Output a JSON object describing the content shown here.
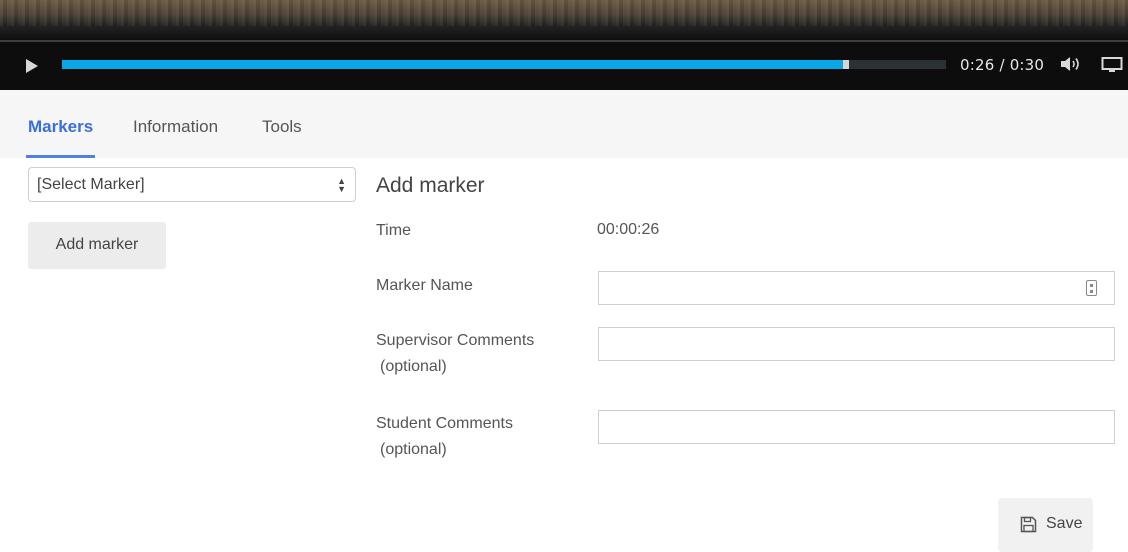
{
  "player": {
    "current_time": "0:26",
    "separator": "/",
    "duration": "0:30",
    "progress_fraction": 0.887,
    "accent_color": "#0aa7e6",
    "icons": [
      "play-icon",
      "volume-icon",
      "screen-icon"
    ]
  },
  "tabs": [
    {
      "label": "Markers",
      "active": true
    },
    {
      "label": "Information",
      "active": false
    },
    {
      "label": "Tools",
      "active": false
    }
  ],
  "marker_select": {
    "value": "[Select Marker]"
  },
  "add_marker_button": "Add marker",
  "form": {
    "title": "Add marker",
    "time_label": "Time",
    "time_value": "00:00:26",
    "marker_name_label": "Marker Name",
    "marker_name_value": "",
    "supervisor_label": "Supervisor Comments",
    "supervisor_optional": "(optional)",
    "supervisor_value": "",
    "student_label": "Student Comments",
    "student_optional": "(optional)",
    "student_value": ""
  },
  "save_button": {
    "label": "Save",
    "icon": "floppy-disk-icon"
  }
}
